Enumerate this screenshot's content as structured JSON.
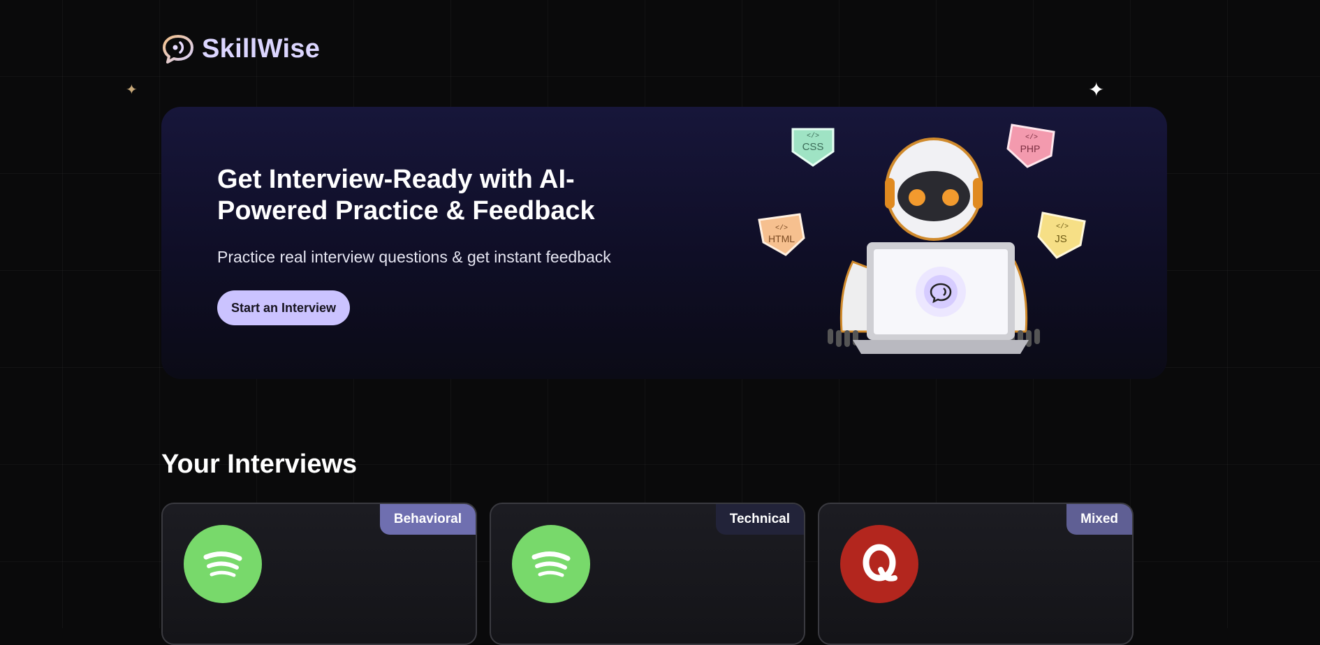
{
  "brand": {
    "name": "SkillWise"
  },
  "hero": {
    "title": "Get Interview-Ready with AI-Powered Practice & Feedback",
    "subtitle": "Practice real interview questions & get instant feedback",
    "cta_label": "Start an Interview",
    "tech_tags": [
      "CSS",
      "PHP",
      "HTML",
      "JS"
    ]
  },
  "interviews": {
    "title": "Your Interviews",
    "cards": [
      {
        "type": "Behavioral",
        "badge_color": "#6f6fb0",
        "logo": "spotify-icon",
        "logo_color": "#78d96b"
      },
      {
        "type": "Technical",
        "badge_color": "#222339",
        "logo": "spotify-icon",
        "logo_color": "#78d96b"
      },
      {
        "type": "Mixed",
        "badge_color": "#5f5f94",
        "logo": "quora-icon",
        "logo_color": "#b3261e"
      }
    ]
  },
  "colors": {
    "accent": "#cbc3ff",
    "background": "#0a0a0b"
  }
}
